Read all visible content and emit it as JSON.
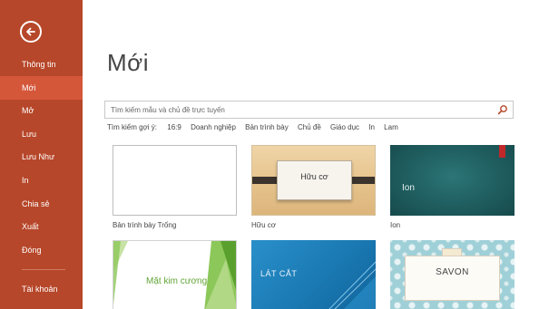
{
  "sidebar": {
    "back_icon": "arrow-left-circle-icon",
    "items": [
      {
        "label": "Thông tin"
      },
      {
        "label": "Mới",
        "active": true
      },
      {
        "label": "Mở"
      },
      {
        "label": "Lưu"
      },
      {
        "label": "Lưu Như"
      },
      {
        "label": "In"
      },
      {
        "label": "Chia sẻ"
      },
      {
        "label": "Xuất"
      },
      {
        "label": "Đóng"
      },
      {
        "label": "Tài khoản"
      }
    ]
  },
  "main": {
    "title": "Mới",
    "search": {
      "placeholder": "Tìm kiếm mẫu và chủ đề trực tuyến",
      "value": "",
      "icon": "search-icon"
    },
    "suggestions": {
      "label": "Tìm kiếm gợi ý:",
      "items": [
        "16:9",
        "Doanh nghiệp",
        "Bản trình bày",
        "Chủ đề",
        "Giáo dục",
        "In",
        "Lam"
      ]
    },
    "templates": [
      {
        "label": "Bản trình bày Trống",
        "thumb_text": ""
      },
      {
        "label": "Hữu cơ",
        "thumb_text": "Hữu cơ"
      },
      {
        "label": "Ion",
        "thumb_text": "Ion"
      },
      {
        "label": "",
        "thumb_text": "Mặt kim cương"
      },
      {
        "label": "",
        "thumb_text": "LÁT CẮT"
      },
      {
        "label": "",
        "thumb_text": "SAVON"
      }
    ]
  },
  "colors": {
    "sidebar_bg": "#b7472a",
    "sidebar_active": "#d5573a",
    "ion_bg": "#1f5d5f",
    "slice_bg": "#1a79b3",
    "facet_green": "#62a436"
  }
}
